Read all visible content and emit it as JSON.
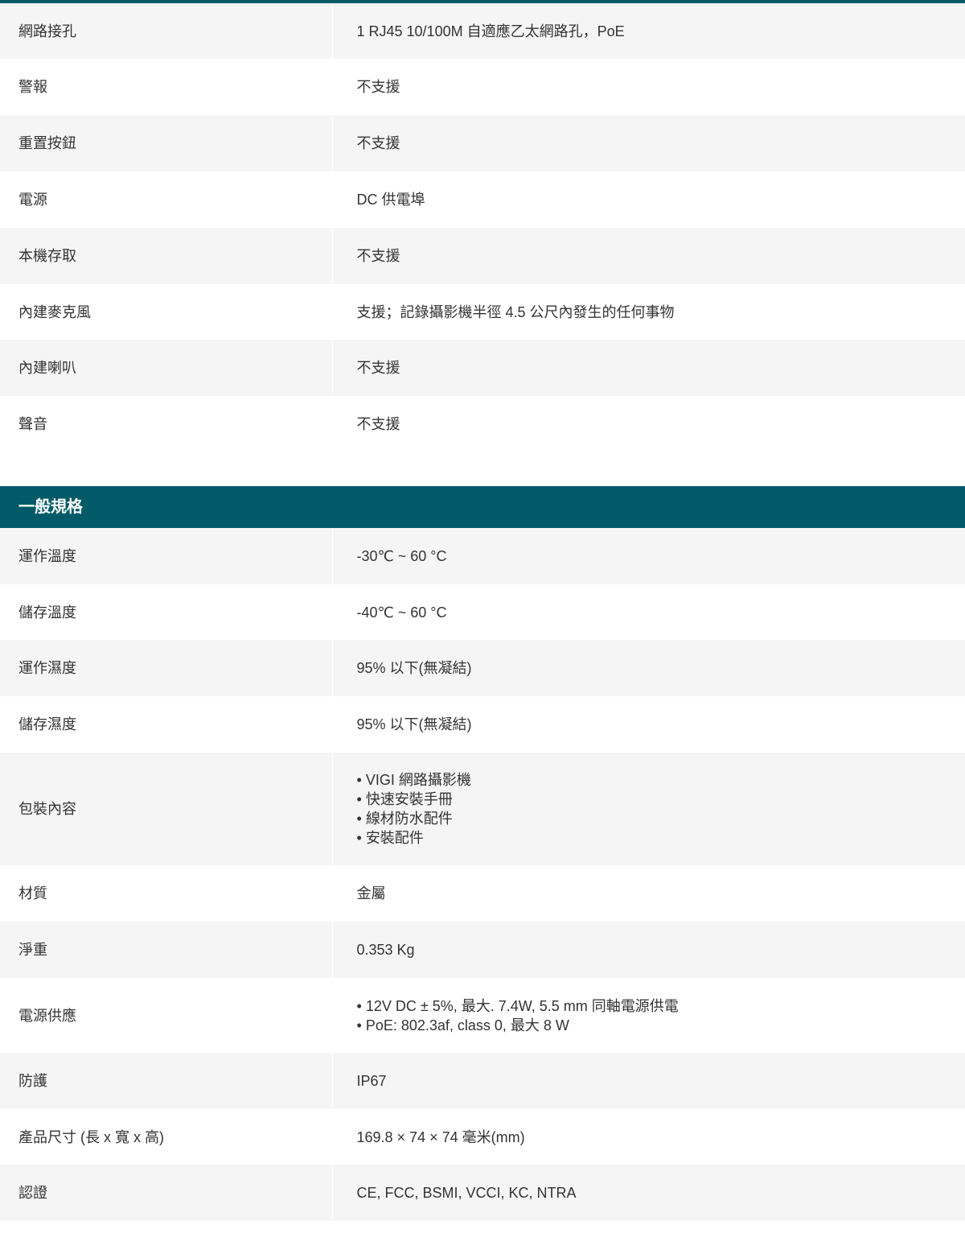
{
  "section1": {
    "rows": [
      {
        "label": "網路接孔",
        "value": "1 RJ45 10/100M 自適應乙太網路孔，PoE"
      },
      {
        "label": "警報",
        "value": "不支援"
      },
      {
        "label": "重置按鈕",
        "value": "不支援"
      },
      {
        "label": "電源",
        "value": "DC 供電埠"
      },
      {
        "label": "本機存取",
        "value": "不支援"
      },
      {
        "label": "內建麥克風",
        "value": "支援；記錄攝影機半徑 4.5 公尺內發生的任何事物"
      },
      {
        "label": "內建喇叭",
        "value": "不支援"
      },
      {
        "label": "聲音",
        "value": "不支援"
      }
    ]
  },
  "section2": {
    "title": "一般規格",
    "r0": {
      "label": "運作溫度",
      "value": "-30℃ ~ 60 °C"
    },
    "r1": {
      "label": "儲存溫度",
      "value": "-40℃ ~ 60 °C"
    },
    "r2": {
      "label": "運作濕度",
      "value": "95% 以下(無凝結)"
    },
    "r3": {
      "label": "儲存濕度",
      "value": "95% 以下(無凝結)"
    },
    "r4": {
      "label": "包裝內容",
      "items": [
        "VIGI 網路攝影機",
        "快速安裝手冊",
        "線材防水配件",
        "安裝配件"
      ]
    },
    "r5": {
      "label": "材質",
      "value": "金屬"
    },
    "r6": {
      "label": "淨重",
      "value": "0.353 Kg"
    },
    "r7": {
      "label": "電源供應",
      "items": [
        "12V DC ± 5%, 最大. 7.4W, 5.5 mm 同軸電源供電",
        "PoE: 802.3af, class 0, 最大 8 W"
      ]
    },
    "r8": {
      "label": "防護",
      "value": "IP67"
    },
    "r9": {
      "label": "產品尺寸 (長 x 寬 x 高)",
      "value": "169.8 × 74 × 74 毫米(mm)"
    },
    "r10": {
      "label": "認證",
      "value": "CE, FCC, BSMI, VCCI, KC, NTRA"
    }
  },
  "colors": {
    "header": "#005a68",
    "shade": "#f5f5f5"
  }
}
